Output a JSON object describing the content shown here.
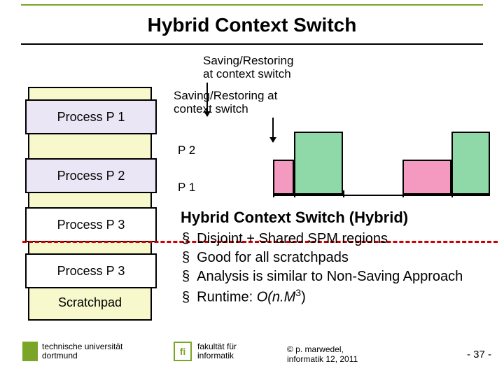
{
  "title": "Hybrid Context Switch",
  "annot1": "Saving/Restoring\nat context switch",
  "annot2": "Saving/Restoring at\ncontext switch",
  "scratchpad": {
    "p1": "Process P 1",
    "p2": "Process P 2",
    "p3a": "Process P 3",
    "p3b": "Process  P 3",
    "label": "Scratchpad"
  },
  "timeline": {
    "p1_label": "P 1",
    "p2_label": "P 2"
  },
  "desc": {
    "heading": "Hybrid Context Switch (Hybrid)",
    "b1": "Disjoint + Shared SPM regions",
    "b2": "Good for all scratchpads",
    "b3": "Analysis is similar to Non-Saving Approach",
    "b4_prefix": "Runtime: ",
    "b4_formula": "O(n.M",
    "b4_sup": "3",
    "b4_close": ")"
  },
  "footer": {
    "uni1": "technische universität",
    "uni2": "dortmund",
    "fi_logo": "fi",
    "fak1": "fakultät für",
    "fak2": "informatik",
    "cpy1": "©  p. marwedel,",
    "cpy2": "informatik 12,  2011",
    "page": "-  37 -"
  },
  "chart_data": {
    "type": "gantt",
    "rows": [
      "P2",
      "P1"
    ],
    "series": [
      {
        "name": "P1",
        "row": "P1",
        "intervals": [
          [
            0,
            30
          ],
          [
            185,
            255
          ]
        ]
      },
      {
        "name": "P2",
        "row": "P2",
        "intervals": [
          [
            30,
            100
          ],
          [
            255,
            310
          ]
        ]
      }
    ],
    "context_switch_markers_x": [
      30,
      100,
      185,
      255
    ]
  }
}
